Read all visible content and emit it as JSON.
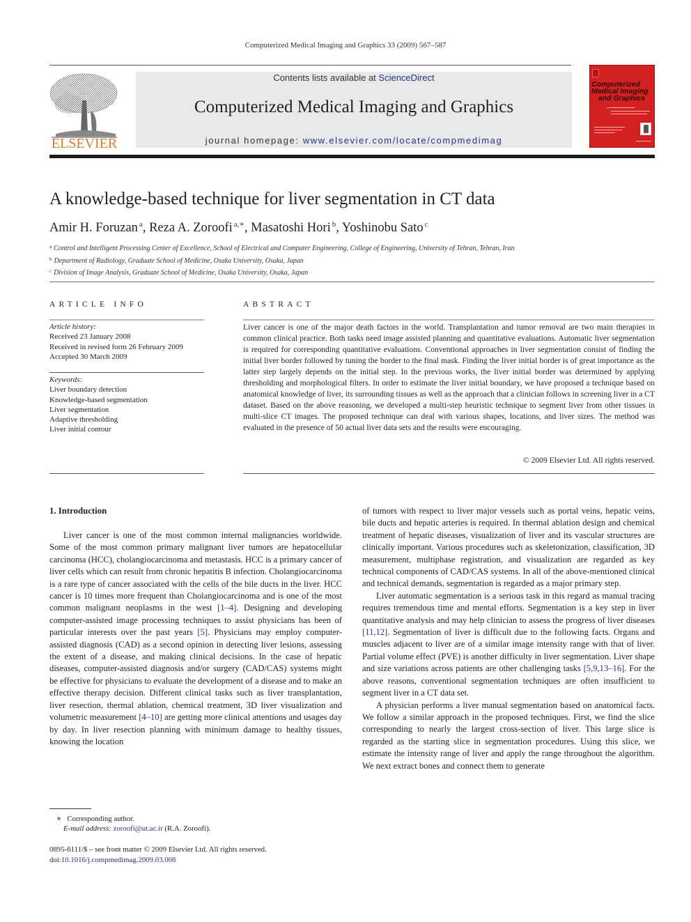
{
  "running_head": "Computerized Medical Imaging and Graphics 33 (2009) 567–587",
  "masthead": {
    "publisher_logo_text": "ELSEVIER",
    "contents_prefix": "Contents lists available at ",
    "contents_link": "ScienceDirect",
    "journal_title": "Computerized Medical Imaging and Graphics",
    "homepage_prefix": "journal homepage: ",
    "homepage_link": "www.elsevier.com/locate/compmedimag",
    "cover_title_lines": [
      "Computerized",
      "Medical Imaging",
      "and Graphics"
    ]
  },
  "colors": {
    "link": "#2a2f8c",
    "elsevier_orange": "#e07a1f",
    "cover_red": "#d42020",
    "masthead_bg": "#e8e9eb"
  },
  "article": {
    "title": "A knowledge-based technique for liver segmentation in CT data",
    "authors": [
      {
        "name": "Amir H. Foruzan",
        "sup": "a",
        "sep": ", "
      },
      {
        "name": "Reza A. Zoroofi",
        "sup": "a,∗",
        "sep": ", "
      },
      {
        "name": "Masatoshi Hori",
        "sup": "b",
        "sep": ", "
      },
      {
        "name": "Yoshinobu Sato",
        "sup": "c",
        "sep": ""
      }
    ],
    "affiliations": [
      {
        "mark": "a",
        "text": "Control and Intelligent Processing Center of Excellence, School of Electrical and Computer Engineering, College of Engineering, University of Tehran, Tehran, Iran"
      },
      {
        "mark": "b",
        "text": "Department of Radiology, Graduate School of Medicine, Osaka University, Osaka, Japan"
      },
      {
        "mark": "c",
        "text": "Division of Image Analysis, Graduate School of Medicine, Osaka University, Osaka, Japan"
      }
    ]
  },
  "article_info": {
    "label": "ARTICLE INFO",
    "history_heading": "Article history:",
    "history": [
      "Received 23 January 2008",
      "Received in revised form 26 February 2009",
      "Accepted 30 March 2009"
    ],
    "keywords_heading": "Keywords:",
    "keywords": [
      "Liver boundary detection",
      "Knowledge-based segmentation",
      "Liver segmentation",
      "Adaptive thresholding",
      "Liver initial contour"
    ]
  },
  "abstract": {
    "label": "ABSTRACT",
    "text": "Liver cancer is one of the major death factors in the world. Transplantation and tumor removal are two main therapies in common clinical practice. Both tasks need image assisted planning and quantitative evaluations. Automatic liver segmentation is required for corresponding quantitative evaluations. Conventional approaches in liver segmentation consist of finding the initial liver border followed by tuning the border to the final mask. Finding the liver initial border is of great importance as the latter step largely depends on the initial step. In the previous works, the liver initial border was determined by applying thresholding and morphological filters. In order to estimate the liver initial boundary, we have proposed a technique based on anatomical knowledge of liver, its surrounding tissues as well as the approach that a clinician follows in screening liver in a CT dataset. Based on the above reasoning, we developed a multi-step heuristic technique to segment liver from other tissues in multi-slice CT images. The proposed technique can deal with various shapes, locations, and liver sizes. The method was evaluated in the presence of 50 actual liver data sets and the results were encouraging.",
    "copyright": "© 2009 Elsevier Ltd. All rights reserved."
  },
  "introduction": {
    "heading": "1.  Introduction",
    "left_column": [
      {
        "segments": [
          {
            "t": "Liver cancer is one of the most common internal malignancies worldwide. Some of the most common primary malignant liver tumors are hepatocellular carcinoma (HCC), cholangiocarcinoma and metastasis. HCC is a primary cancer of liver cells which can result from chronic hepatitis B infection. Cholangiocarcinoma is a rare type of cancer associated with the cells of the bile ducts in the liver. HCC cancer is 10 times more frequent than Cholangiocarcinoma and is one of the most common malignant neoplasms in the west "
          },
          {
            "t": "[1–4]",
            "ref": true
          },
          {
            "t": ". Designing and developing computer-assisted image processing techniques to assist physicians has been of particular interests over the past years "
          },
          {
            "t": "[5]",
            "ref": true
          },
          {
            "t": ". Physicians may employ computer-assisted diagnosis (CAD) as a second opinion in detecting liver lesions, assessing the extent of a disease, and making clinical decisions. In the case of hepatic diseases, computer-assisted diagnosis and/or surgery (CAD/CAS) systems might be effective for physicians to evaluate the development of a disease and to make an effective therapy decision. Different clinical tasks such as liver transplantation, liver resection, thermal ablation, chemical treatment, 3D liver visualization and volumetric measurement "
          },
          {
            "t": "[4–10]",
            "ref": true
          },
          {
            "t": " are getting more clinical attentions and usages day by day. In liver resection planning with minimum damage to healthy tissues, knowing the location"
          }
        ]
      }
    ],
    "right_column": [
      {
        "indent": false,
        "segments": [
          {
            "t": "of tumors with respect to liver major vessels such as portal veins, hepatic veins, bile ducts and hepatic arteries is required. In thermal ablation design and chemical treatment of hepatic diseases, visualization of liver and its vascular structures are clinically important. Various procedures such as skeletonization, classification, 3D measurement, multiphase registration, and visualization are regarded as key technical components of CAD/CAS systems. In all of the above-mentioned clinical and technical demands, segmentation is regarded as a major primary step."
          }
        ]
      },
      {
        "indent": true,
        "segments": [
          {
            "t": "Liver automatic segmentation is a serious task in this regard as manual tracing requires tremendous time and mental efforts. Segmentation is a key step in liver quantitative analysis and may help clinician to assess the progress of liver diseases "
          },
          {
            "t": "[11,12]",
            "ref": true
          },
          {
            "t": ". Segmentation of liver is difficult due to the following facts. Organs and muscles adjacent to liver are of a similar image intensity range with that of liver. Partial volume effect (PVE) is another difficulty in liver segmentation. Liver shape and size variations across patients are other challenging tasks "
          },
          {
            "t": "[5,9,13–16]",
            "ref": true
          },
          {
            "t": ". For the above reasons, conventional segmentation techniques are often insufficient to segment liver in a CT data set."
          }
        ]
      },
      {
        "indent": true,
        "segments": [
          {
            "t": "A physician performs a liver manual segmentation based on anatomical facts. We follow a similar approach in the proposed techniques. First, we find the slice corresponding to nearly the largest cross-section of liver. This large slice is regarded as the starting slice in segmentation procedures. Using this slice, we estimate the intensity range of liver and apply the range throughout the algorithm. We next extract bones and connect them to generate"
          }
        ]
      }
    ]
  },
  "footnote": {
    "mark": "∗",
    "corresponding": "Corresponding author.",
    "email_label": "E-mail address:",
    "email": "zoroofi@ut.ac.ir",
    "email_owner": "(R.A. Zoroofi)."
  },
  "front_matter": {
    "issn_line": "0895-6111/$ – see front matter © 2009 Elsevier Ltd. All rights reserved.",
    "doi_prefix": "doi:",
    "doi": "10.1016/j.compmedimag.2009.03.008"
  }
}
